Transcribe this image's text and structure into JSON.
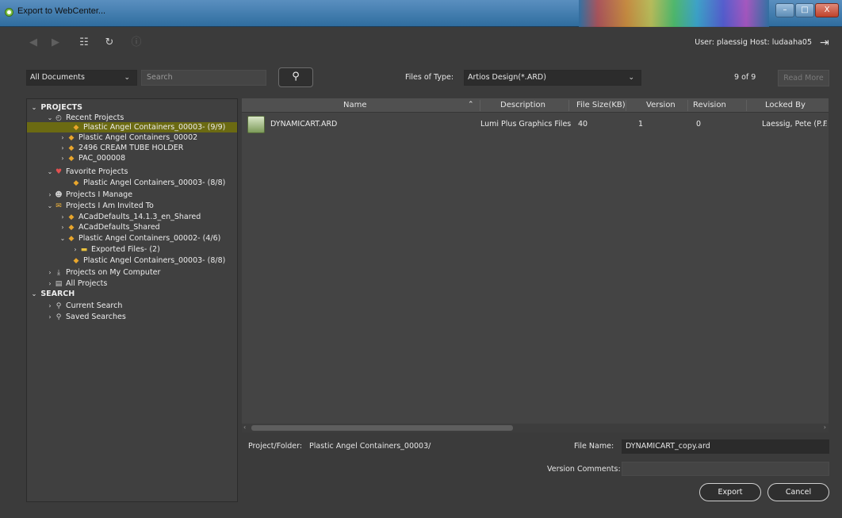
{
  "window": {
    "title": "Export to WebCenter...",
    "controls": [
      "–",
      "□",
      "X"
    ]
  },
  "toolbar": {
    "user_text": "User: plaessig  Host: ludaaha05"
  },
  "filters": {
    "scope_value": "All Documents",
    "search_placeholder": "Search",
    "files_of_type_label": "Files of Type:",
    "files_of_type_value": "Artios Design(*.ARD)",
    "count_text": "9 of 9",
    "read_more_label": "Read More"
  },
  "tree": {
    "projects": "PROJECTS",
    "recent": "Recent Projects",
    "recent_items": [
      "Plastic Angel Containers_00003- (9/9)",
      "Plastic Angel Containers_00002",
      "2496 CREAM TUBE HOLDER",
      "PAC_000008"
    ],
    "favorite": "Favorite Projects",
    "favorite_items": [
      "Plastic Angel Containers_00003- (8/8)"
    ],
    "manage": "Projects I Manage",
    "invited": "Projects I Am Invited To",
    "invited_items": [
      "ACadDefaults_14.1.3_en_Shared",
      "ACadDefaults_Shared",
      "Plastic Angel Containers_00002- (4/6)",
      "Exported Files- (2)",
      "Plastic Angel Containers_00003- (8/8)"
    ],
    "on_computer": "Projects on My Computer",
    "all": "All Projects",
    "search": "SEARCH",
    "current_search": "Current Search",
    "saved_searches": "Saved Searches"
  },
  "table": {
    "columns": [
      "Name",
      "Description",
      "File Size(KB)",
      "Version",
      "Revision",
      "Locked By"
    ],
    "rows": [
      {
        "name": "DYNAMICART.ARD",
        "description": "Lumi Plus Graphics Files",
        "size": "40",
        "version": "1",
        "revision": "0",
        "locked_by": "Laessig, Pete (P...",
        "extra": "F"
      }
    ]
  },
  "bottom": {
    "folder_label": "Project/Folder:",
    "folder_value": "Plastic Angel Containers_00003/",
    "file_name_label": "File Name:",
    "file_name_value": "DYNAMICART_copy.ard",
    "comments_label": "Version Comments:",
    "comments_value": "",
    "export_label": "Export",
    "cancel_label": "Cancel"
  },
  "colors": {
    "highlight": "#6b6a12",
    "background": "#3b3b3b"
  }
}
